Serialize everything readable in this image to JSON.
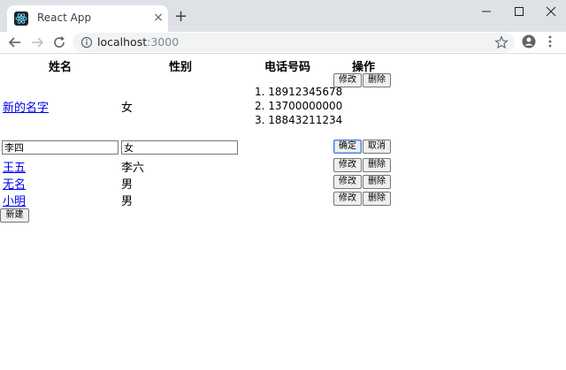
{
  "browser": {
    "tab_title": "React App",
    "tab_close": "×",
    "new_tab": "+",
    "url_host": "localhost",
    "url_port": ":3000"
  },
  "table": {
    "headers": {
      "name": "姓名",
      "gender": "性别",
      "phone": "电话号码",
      "ops": "操作"
    },
    "rows": [
      {
        "name": "新的名字",
        "gender": "女",
        "phones": [
          "1. 18912345678",
          "2. 13700000000",
          "3. 18843211234"
        ]
      },
      {
        "name": "王五",
        "gender": "李六"
      },
      {
        "name": "无名",
        "gender": "男"
      },
      {
        "name": "小明",
        "gender": "男"
      }
    ],
    "edit_row": {
      "name_value": "李四",
      "gender_value": "女"
    }
  },
  "buttons": {
    "edit": "修改",
    "delete": "删除",
    "confirm": "确定",
    "cancel": "取消",
    "new": "新建"
  },
  "colors": {
    "link": "#0000ee",
    "tabbar": "#dee1e6",
    "omnibox": "#f1f3f4"
  }
}
